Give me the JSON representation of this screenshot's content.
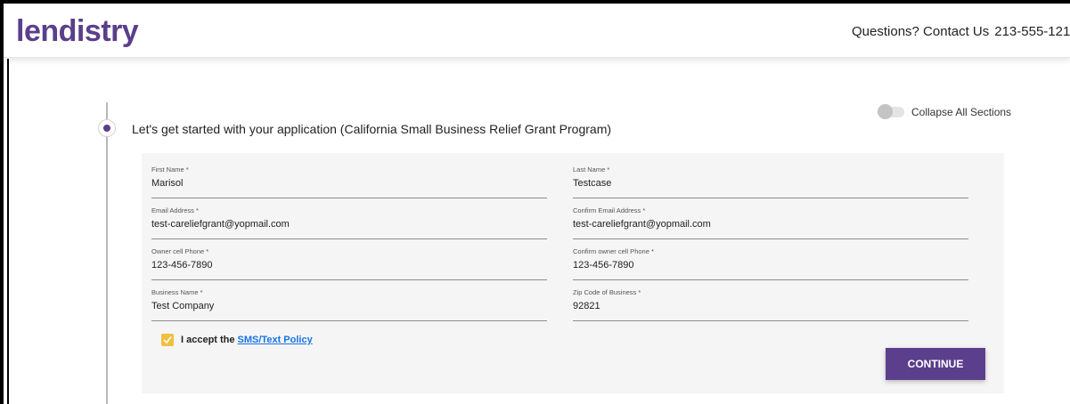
{
  "header": {
    "logo_text": "lendistry",
    "contact_label": "Questions? Contact Us",
    "phone": "213-555-121"
  },
  "section": {
    "title": "Let's get started with your application  (California Small Business Relief Grant Program)",
    "collapse_label": "Collapse All Sections"
  },
  "form": {
    "first_name": {
      "label": "First Name *",
      "value": "Marisol"
    },
    "last_name": {
      "label": "Last Name *",
      "value": "Testcase"
    },
    "email": {
      "label": "Email Address *",
      "value": "test-careliefgrant@yopmail.com"
    },
    "confirm_email": {
      "label": "Confirm Email Address *",
      "value": "test-careliefgrant@yopmail.com"
    },
    "owner_phone": {
      "label": "Owner cell Phone *",
      "value": "123-456-7890"
    },
    "confirm_phone": {
      "label": "Confirm owner cell Phone *",
      "value": "123-456-7890"
    },
    "business_name": {
      "label": "Business Name *",
      "value": "Test Company"
    },
    "zip": {
      "label": "Zip Code of Business *",
      "value": "92821"
    }
  },
  "consent": {
    "accept_text": "I accept the",
    "link_text": "SMS/Text Policy",
    "checked": true
  },
  "actions": {
    "continue_label": "CONTINUE"
  },
  "colors": {
    "brand_purple": "#5c3f8c",
    "checkbox_yellow": "#f3bf42",
    "link_blue": "#1a73e8"
  }
}
